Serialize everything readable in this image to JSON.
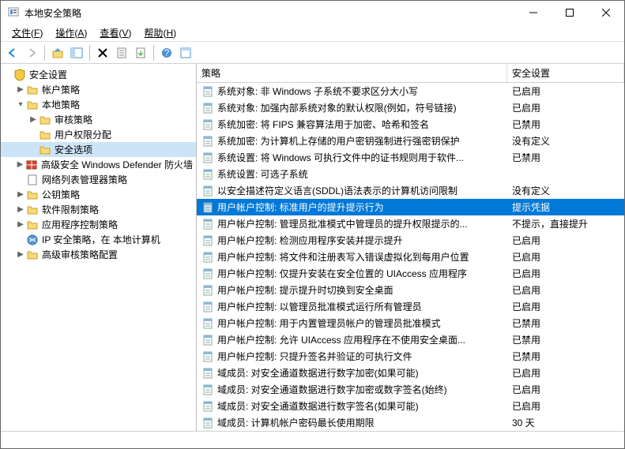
{
  "window": {
    "title": "本地安全策略"
  },
  "menu": {
    "file": {
      "label": "文件",
      "key": "F"
    },
    "action": {
      "label": "操作",
      "key": "A"
    },
    "view": {
      "label": "查看",
      "key": "V"
    },
    "help": {
      "label": "帮助",
      "key": "H"
    }
  },
  "tree": {
    "root": "安全设置",
    "items": [
      {
        "label": "帐户策略",
        "indent": 1,
        "expander": "▶",
        "icon": "folder"
      },
      {
        "label": "本地策略",
        "indent": 1,
        "expander": "▾",
        "icon": "folder"
      },
      {
        "label": "审核策略",
        "indent": 2,
        "expander": "▶",
        "icon": "folder"
      },
      {
        "label": "用户权限分配",
        "indent": 2,
        "expander": "",
        "icon": "folder"
      },
      {
        "label": "安全选项",
        "indent": 2,
        "expander": "",
        "icon": "folder",
        "selected": true
      },
      {
        "label": "高级安全 Windows Defender 防火墙",
        "indent": 1,
        "expander": "▶",
        "icon": "firewall"
      },
      {
        "label": "网络列表管理器策略",
        "indent": 1,
        "expander": "",
        "icon": "page"
      },
      {
        "label": "公钥策略",
        "indent": 1,
        "expander": "▶",
        "icon": "folder"
      },
      {
        "label": "软件限制策略",
        "indent": 1,
        "expander": "▶",
        "icon": "folder"
      },
      {
        "label": "应用程序控制策略",
        "indent": 1,
        "expander": "▶",
        "icon": "folder"
      },
      {
        "label": "IP 安全策略，在 本地计算机",
        "indent": 1,
        "expander": "",
        "icon": "ip"
      },
      {
        "label": "高级审核策略配置",
        "indent": 1,
        "expander": "▶",
        "icon": "folder"
      }
    ]
  },
  "columns": {
    "policy": "策略",
    "setting": "安全设置"
  },
  "policies": [
    {
      "name": "系统对象: 非 Windows 子系统不要求区分大小写",
      "setting": "已启用"
    },
    {
      "name": "系统对象: 加强内部系统对象的默认权限(例如，符号链接)",
      "setting": "已启用"
    },
    {
      "name": "系统加密: 将 FIPS 兼容算法用于加密、哈希和签名",
      "setting": "已禁用"
    },
    {
      "name": "系统加密: 为计算机上存储的用户密钥强制进行强密钥保护",
      "setting": "没有定义"
    },
    {
      "name": "系统设置: 将 Windows 可执行文件中的证书规则用于软件...",
      "setting": "已禁用"
    },
    {
      "name": "系统设置: 可选子系统",
      "setting": ""
    },
    {
      "name": "以安全描述符定义语言(SDDL)语法表示的计算机访问限制",
      "setting": "没有定义"
    },
    {
      "name": "用户帐户控制: 标准用户的提升提示行为",
      "setting": "提示凭据",
      "selected": true
    },
    {
      "name": "用户帐户控制: 管理员批准模式中管理员的提升权限提示的...",
      "setting": "不提示，直接提升"
    },
    {
      "name": "用户帐户控制: 检测应用程序安装并提示提升",
      "setting": "已启用"
    },
    {
      "name": "用户帐户控制: 将文件和注册表写入错误虚拟化到每用户位置",
      "setting": "已启用"
    },
    {
      "name": "用户帐户控制: 仅提升安装在安全位置的 UIAccess 应用程序",
      "setting": "已启用"
    },
    {
      "name": "用户帐户控制: 提示提升时切换到安全桌面",
      "setting": "已启用"
    },
    {
      "name": "用户帐户控制: 以管理员批准模式运行所有管理员",
      "setting": "已启用"
    },
    {
      "name": "用户帐户控制: 用于内置管理员帐户的管理员批准模式",
      "setting": "已禁用"
    },
    {
      "name": "用户帐户控制: 允许 UIAccess 应用程序在不使用安全桌面...",
      "setting": "已禁用"
    },
    {
      "name": "用户帐户控制: 只提升签名并验证的可执行文件",
      "setting": "已禁用"
    },
    {
      "name": "域成员: 对安全通道数据进行数字加密(如果可能)",
      "setting": "已启用"
    },
    {
      "name": "域成员: 对安全通道数据进行数字加密或数字签名(始终)",
      "setting": "已启用"
    },
    {
      "name": "域成员: 对安全通道数据进行数字签名(如果可能)",
      "setting": "已启用"
    },
    {
      "name": "域成员: 计算机帐户密码最长使用期限",
      "setting": "30 天"
    }
  ]
}
